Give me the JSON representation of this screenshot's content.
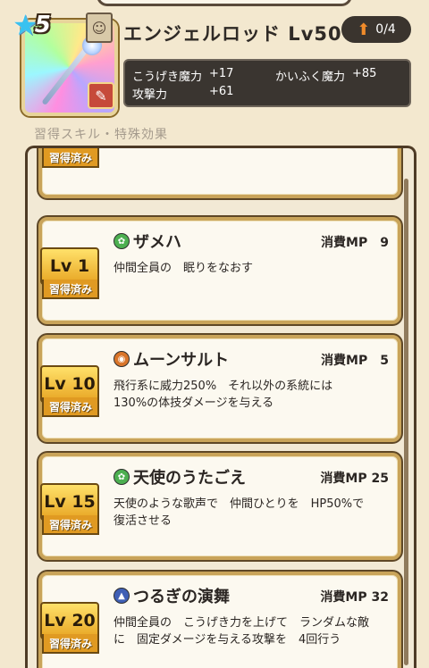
{
  "weapon": {
    "rarity": "5",
    "name": "エンジェルロッド Lv50",
    "upgrade": "0/4",
    "type_icon": "staff-type-icon",
    "stats": [
      {
        "label": "こうげき魔力",
        "value": "+17"
      },
      {
        "label": "攻撃力",
        "value": "+61"
      },
      {
        "label": "かいふく魔力",
        "value": "+85"
      }
    ]
  },
  "section_title": "習得スキル・特殊効果",
  "partial_card": {
    "learned": "習得済み"
  },
  "skills": [
    {
      "level": "Lv 1",
      "learned": "習得済み",
      "icon": "wind-element-icon",
      "icon_color": "#4caf50",
      "name": "ザメハ",
      "mp": "消費MP　9",
      "desc": "仲間全員の　眠りをなおす"
    },
    {
      "level": "Lv 10",
      "learned": "習得済み",
      "icon": "physical-element-icon",
      "icon_color": "#d9752a",
      "name": "ムーンサルト",
      "mp": "消費MP　5",
      "desc": "飛行系に威力250%　それ以外の系統には\n130%の体技ダメージを与える"
    },
    {
      "level": "Lv 15",
      "learned": "習得済み",
      "icon": "wind-element-icon",
      "icon_color": "#4caf50",
      "name": "天使のうたごえ",
      "mp": "消費MP 25",
      "desc": "天使のような歌声で　仲間ひとりを　HP50%で\n復活させる"
    },
    {
      "level": "Lv 20",
      "learned": "習得済み",
      "icon": "buff-element-icon",
      "icon_color": "#3f5fb5",
      "name": "つるぎの演舞",
      "mp": "消費MP 32",
      "desc": "仲間全員の　こうげき力を上げて　ランダムな敵\nに　固定ダメージを与える攻撃を　4回行う"
    }
  ]
}
